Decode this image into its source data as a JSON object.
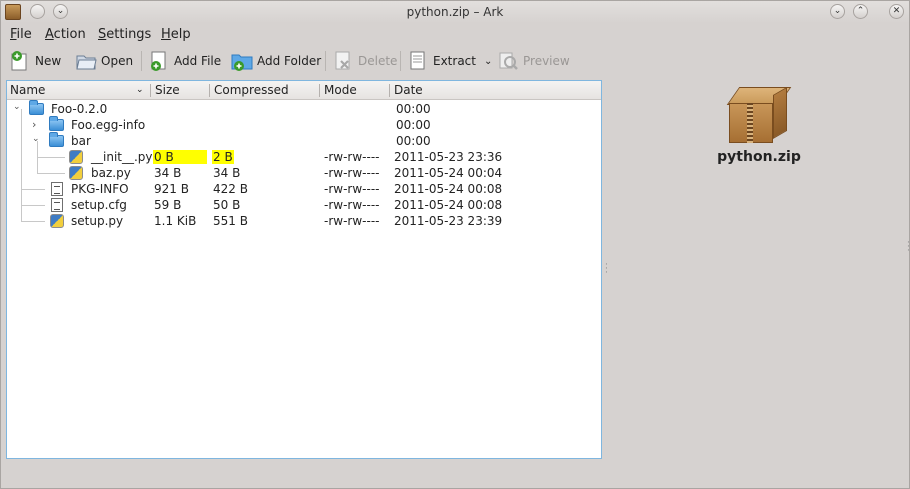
{
  "window": {
    "title": "python.zip – Ark",
    "controls": {
      "minimize": "⌄",
      "maximize": "⌃",
      "close": "✕"
    }
  },
  "menu": [
    {
      "label_u": "F",
      "label_rest": "ile"
    },
    {
      "label_u": "A",
      "label_rest": "ction"
    },
    {
      "label_u": "S",
      "label_rest": "ettings"
    },
    {
      "label_u": "H",
      "label_rest": "elp"
    }
  ],
  "toolbar": {
    "new": "New",
    "open": "Open",
    "add_file": "Add File",
    "add_folder": "Add Folder",
    "delete": "Delete",
    "extract": "Extract",
    "preview": "Preview"
  },
  "columns": {
    "name": "Name",
    "size": "Size",
    "compressed": "Compressed",
    "mode": "Mode",
    "date": "Date"
  },
  "rows": [
    {
      "name": "Foo-0.2.0",
      "size": "",
      "compressed": "",
      "mode": "",
      "date": "00:00",
      "type": "folder",
      "depth": 0,
      "expander": "⌄"
    },
    {
      "name": "Foo.egg-info",
      "size": "",
      "compressed": "",
      "mode": "",
      "date": "00:00",
      "type": "folder",
      "depth": 1,
      "expander": "›"
    },
    {
      "name": "bar",
      "size": "",
      "compressed": "",
      "mode": "",
      "date": "00:00",
      "type": "folder",
      "depth": 1,
      "expander": "⌄"
    },
    {
      "name": "__init__.py",
      "size": "0 B",
      "compressed": "2 B",
      "mode": "-rw-rw----",
      "date": "2011-05-23 23:36",
      "type": "python",
      "depth": 2,
      "highlight": true
    },
    {
      "name": "baz.py",
      "size": "34 B",
      "compressed": "34 B",
      "mode": "-rw-rw----",
      "date": "2011-05-24 00:04",
      "type": "python",
      "depth": 2
    },
    {
      "name": "PKG-INFO",
      "size": "921 B",
      "compressed": "422 B",
      "mode": "-rw-rw----",
      "date": "2011-05-24 00:08",
      "type": "text",
      "depth": 1
    },
    {
      "name": "setup.cfg",
      "size": "59 B",
      "compressed": "50 B",
      "mode": "-rw-rw----",
      "date": "2011-05-24 00:08",
      "type": "text",
      "depth": 1
    },
    {
      "name": "setup.py",
      "size": "1.1 KiB",
      "compressed": "551 B",
      "mode": "-rw-rw----",
      "date": "2011-05-23 23:39",
      "type": "python",
      "depth": 1
    }
  ],
  "preview": {
    "filename": "python.zip",
    "icon": "archive-box-icon"
  },
  "colors": {
    "highlight": "#ffff00",
    "selection_border": "#7fb6df",
    "folder": "#3b8fd6"
  }
}
